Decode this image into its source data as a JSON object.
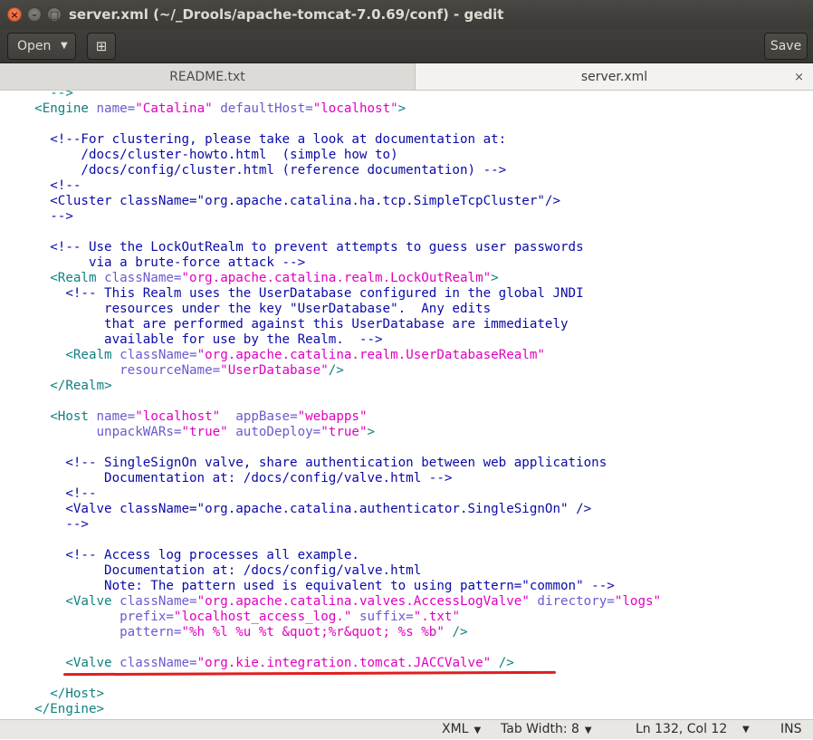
{
  "window": {
    "title": "server.xml (~/_Drools/apache-tomcat-7.0.69/conf) - gedit",
    "close_glyph": "×",
    "minimize_glyph": "–",
    "maximize_glyph": "□"
  },
  "header": {
    "open_label": "Open",
    "open_arrow_icon": "▼",
    "new_document_icon": "⊞",
    "save_label": "Save"
  },
  "tabs": [
    {
      "label": "README.txt",
      "active": false
    },
    {
      "label": "server.xml",
      "active": true,
      "close_icon": "×"
    }
  ],
  "editor": {
    "lines": [
      "      -->",
      "    <Engine name=\"Catalina\" defaultHost=\"localhost\">",
      "",
      "      <!--For clustering, please take a look at documentation at:",
      "          /docs/cluster-howto.html  (simple how to)",
      "          /docs/config/cluster.html (reference documentation) -->",
      "      <!--",
      "      <Cluster className=\"org.apache.catalina.ha.tcp.SimpleTcpCluster\"/>",
      "      -->",
      "",
      "      <!-- Use the LockOutRealm to prevent attempts to guess user passwords",
      "           via a brute-force attack -->",
      "      <Realm className=\"org.apache.catalina.realm.LockOutRealm\">",
      "        <!-- This Realm uses the UserDatabase configured in the global JNDI",
      "             resources under the key \"UserDatabase\".  Any edits",
      "             that are performed against this UserDatabase are immediately",
      "             available for use by the Realm.  -->",
      "        <Realm className=\"org.apache.catalina.realm.UserDatabaseRealm\"",
      "               resourceName=\"UserDatabase\"/>",
      "      </Realm>",
      "",
      "      <Host name=\"localhost\"  appBase=\"webapps\"",
      "            unpackWARs=\"true\" autoDeploy=\"true\">",
      "",
      "        <!-- SingleSignOn valve, share authentication between web applications",
      "             Documentation at: /docs/config/valve.html -->",
      "        <!--",
      "        <Valve className=\"org.apache.catalina.authenticator.SingleSignOn\" />",
      "        -->",
      "",
      "        <!-- Access log processes all example.",
      "             Documentation at: /docs/config/valve.html",
      "             Note: The pattern used is equivalent to using pattern=\"common\" -->",
      "        <Valve className=\"org.apache.catalina.valves.AccessLogValve\" directory=\"logs\"",
      "               prefix=\"localhost_access_log.\" suffix=\".txt\"",
      "               pattern=\"%h %l %u %t &quot;%r&quot; %s %b\" />",
      "",
      "        <Valve className=\"org.kie.integration.tomcat.JACCValve\" />",
      "",
      "      </Host>",
      "    </Engine>"
    ]
  },
  "status": {
    "language": "XML",
    "tab_width": "Tab Width: 8",
    "position": "Ln 132, Col 12",
    "dropdown_icon": "▼",
    "mode": "INS"
  },
  "colors": {
    "comment": "#0a0aa8",
    "tag": "#108080",
    "attribute": "#6a5acd",
    "string": "#e000c0",
    "annotation_underline": "#e01e1e"
  }
}
